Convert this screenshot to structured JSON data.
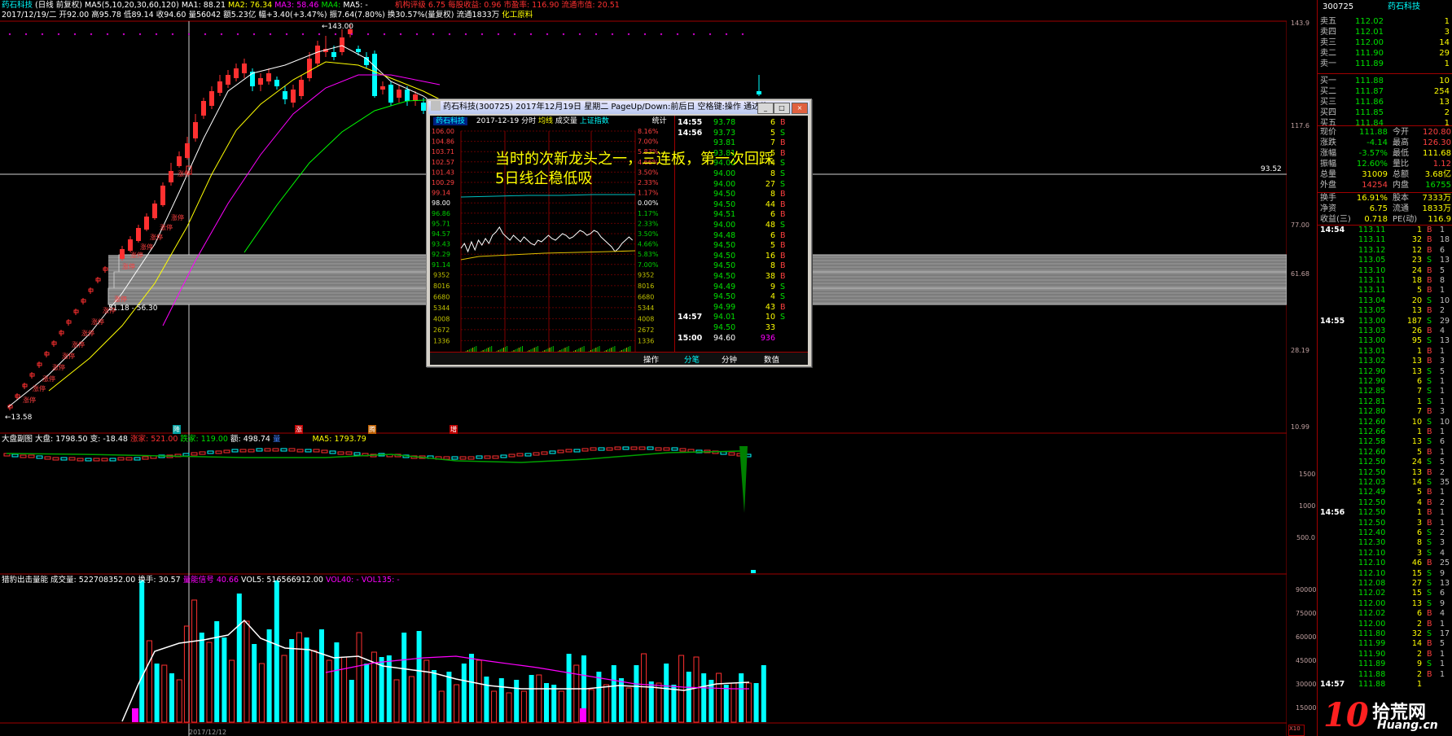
{
  "main_header": {
    "name": "药石科技",
    "period": "(日线 前复权)",
    "ma_params": "MA5(5,10,20,30,60,120)",
    "ma1": "MA1: 88.21",
    "ma2": "MA2: 76.34",
    "ma3": "MA3: 58.46",
    "ma4": "MA4:",
    "ma5": "MA5: -",
    "ratings": "机构评级",
    "profit": "6.75 每股收益: 0.96 市盈率: 116.90 流通市值: 20.51"
  },
  "info_line": {
    "date": "2017/12/19/二",
    "open": "开92.00",
    "high": "高95.78",
    "low": "低89.14",
    "close": "收94.60",
    "volume": "量56042",
    "amount": "额5.23亿",
    "change": "幅+3.40(+3.47%)",
    "amplitude": "振7.64(7.80%)",
    "turnover": "换30.57%(量复权)",
    "float_shares": "流通1833万",
    "industry": "化工原料"
  },
  "price_labels": {
    "high": "143.00",
    "low": "13.58",
    "band": "51.18 - 56.30",
    "right_mark": "93.52"
  },
  "right_axis": [
    "143.9",
    "117.6",
    "77.00",
    "61.68",
    "28.19",
    "10.99"
  ],
  "up_limit_text": "涨停",
  "candle_markers": [
    "降",
    "涨",
    "腾",
    "增"
  ],
  "index_header": {
    "title": "大盘副图",
    "dapan": "大盘: 1798.50",
    "change": "变: -18.48",
    "up": "涨家: 521.00",
    "down": "跌家: 119.00",
    "amount": "额: 498.74",
    "vol": "量",
    "ma5": "MA5: 1793.79"
  },
  "index_axis": [
    "1500",
    "1000",
    "500.0"
  ],
  "volume_header": {
    "title": "猎豹出击量能",
    "volume": "成交量: 522708352.00",
    "turnover": "换手: 30.57",
    "signal": "量能信号",
    "signal_val": "40.66",
    "vol5": "VOL5: 516566912.00",
    "vol40": "VOL40: -",
    "vol135": "VOL135: -"
  },
  "volume_axis": [
    "90000",
    "75000",
    "60000",
    "45000",
    "30000",
    "15000"
  ],
  "bottom_axis": [
    "2017/12/12",
    "X10"
  ],
  "annotation": {
    "line1": "当时的次新龙头之一，三连板，第一次回踩",
    "line2": "5日线企稳低吸"
  },
  "popup": {
    "title": "药石科技(300725) 2017年12月19日 星期二 PageUp/Down:前后日 空格键:操作 通达信(R)",
    "tab_name": "药石科技",
    "tab_date": "2017-12-19",
    "tab_fenshi": "分时",
    "tab_avg": "均线",
    "tab_vol": "成交量",
    "tab_index": "上证指数",
    "tab_stat": "统计",
    "left_axis": [
      "106.00",
      "104.86",
      "103.71",
      "102.57",
      "101.43",
      "100.29",
      "99.14",
      "98.00",
      "96.86",
      "95.71",
      "94.57",
      "93.43",
      "92.29",
      "91.14",
      "9352",
      "8016",
      "6680",
      "5344",
      "4008",
      "2672",
      "1336"
    ],
    "right_axis": [
      "8.16%",
      "7.00%",
      "5.83%",
      "4.66%",
      "3.50%",
      "2.33%",
      "1.17%",
      "0.00%",
      "1.17%",
      "2.33%",
      "3.50%",
      "4.66%",
      "5.83%",
      "7.00%",
      "9352",
      "8016",
      "6680",
      "5344",
      "4008",
      "2672",
      "1336"
    ],
    "time_axis": [
      "09:30",
      "10:30",
      "13:00",
      "14:00"
    ],
    "btn_op": "操作",
    "btn_tabs": [
      "分笔",
      "分钟",
      "数值"
    ],
    "ticks": [
      {
        "t": "14:55",
        "p": "93.78",
        "v": "6",
        "d": "B"
      },
      {
        "t": "14:56",
        "p": "93.73",
        "v": "5",
        "d": "S"
      },
      {
        "t": "",
        "p": "93.81",
        "v": "7",
        "d": "B"
      },
      {
        "t": "",
        "p": "93.81",
        "v": "5",
        "d": "B"
      },
      {
        "t": "",
        "p": "94.00",
        "v": "4",
        "d": "S"
      },
      {
        "t": "",
        "p": "94.00",
        "v": "8",
        "d": "S"
      },
      {
        "t": "",
        "p": "94.00",
        "v": "27",
        "d": "S"
      },
      {
        "t": "",
        "p": "94.50",
        "v": "8",
        "d": "B"
      },
      {
        "t": "",
        "p": "94.50",
        "v": "44",
        "d": "B"
      },
      {
        "t": "",
        "p": "94.51",
        "v": "6",
        "d": "B"
      },
      {
        "t": "",
        "p": "94.00",
        "v": "48",
        "d": "S"
      },
      {
        "t": "",
        "p": "94.48",
        "v": "6",
        "d": "B"
      },
      {
        "t": "",
        "p": "94.50",
        "v": "5",
        "d": "B"
      },
      {
        "t": "",
        "p": "94.50",
        "v": "16",
        "d": "B"
      },
      {
        "t": "",
        "p": "94.50",
        "v": "8",
        "d": "B"
      },
      {
        "t": "",
        "p": "94.50",
        "v": "38",
        "d": "B"
      },
      {
        "t": "",
        "p": "94.49",
        "v": "9",
        "d": "S"
      },
      {
        "t": "",
        "p": "94.50",
        "v": "4",
        "d": "S"
      },
      {
        "t": "",
        "p": "94.99",
        "v": "43",
        "d": "B"
      },
      {
        "t": "14:57",
        "p": "94.01",
        "v": "10",
        "d": "S"
      },
      {
        "t": "",
        "p": "94.50",
        "v": "33",
        "d": ""
      },
      {
        "t": "15:00",
        "p": "94.60",
        "v": "936",
        "d": ""
      }
    ]
  },
  "quote": {
    "code": "300725",
    "name": "药石科技",
    "asks": [
      {
        "label": "卖五",
        "price": "112.02",
        "vol": "1"
      },
      {
        "label": "卖四",
        "price": "112.01",
        "vol": "3"
      },
      {
        "label": "卖三",
        "price": "112.00",
        "vol": "14"
      },
      {
        "label": "卖二",
        "price": "111.90",
        "vol": "29"
      },
      {
        "label": "卖一",
        "price": "111.89",
        "vol": "1"
      }
    ],
    "bids": [
      {
        "label": "买一",
        "price": "111.88",
        "vol": "10"
      },
      {
        "label": "买二",
        "price": "111.87",
        "vol": "254"
      },
      {
        "label": "买三",
        "price": "111.86",
        "vol": "13"
      },
      {
        "label": "买四",
        "price": "111.85",
        "vol": "2"
      },
      {
        "label": "买五",
        "price": "111.84",
        "vol": "1"
      }
    ],
    "stats": [
      {
        "l1": "现价",
        "v1": "111.88",
        "l2": "今开",
        "v2": "120.80"
      },
      {
        "l1": "涨跌",
        "v1": "-4.14",
        "l2": "最高",
        "v2": "126.30"
      },
      {
        "l1": "涨幅",
        "v1": "-3.57%",
        "l2": "最低",
        "v2": "111.68"
      },
      {
        "l1": "振幅",
        "v1": "12.60%",
        "l2": "量比",
        "v2": "1.12"
      },
      {
        "l1": "总量",
        "v1": "31009",
        "l2": "总额",
        "v2": "3.68亿"
      },
      {
        "l1": "外盘",
        "v1": "14254",
        "l2": "内盘",
        "v2": "16755"
      },
      {
        "l1": "换手",
        "v1": "16.91%",
        "l2": "股本",
        "v2": "7333万"
      },
      {
        "l1": "净资",
        "v1": "6.75",
        "l2": "流通",
        "v2": "1833万"
      },
      {
        "l1": "收益(三)",
        "v1": "0.718",
        "l2": "PE(动)",
        "v2": "116.9"
      }
    ],
    "ticks": [
      {
        "t": "14:54",
        "p": "113.11",
        "v": "1",
        "d": "B",
        "n": "1"
      },
      {
        "t": "",
        "p": "113.11",
        "v": "32",
        "d": "B",
        "n": "18"
      },
      {
        "t": "",
        "p": "113.12",
        "v": "12",
        "d": "B",
        "n": "6"
      },
      {
        "t": "",
        "p": "113.05",
        "v": "23",
        "d": "S",
        "n": "13"
      },
      {
        "t": "",
        "p": "113.10",
        "v": "24",
        "d": "B",
        "n": "5"
      },
      {
        "t": "",
        "p": "113.11",
        "v": "18",
        "d": "B",
        "n": "8"
      },
      {
        "t": "",
        "p": "113.11",
        "v": "5",
        "d": "B",
        "n": "1"
      },
      {
        "t": "",
        "p": "113.04",
        "v": "20",
        "d": "S",
        "n": "10"
      },
      {
        "t": "",
        "p": "113.05",
        "v": "13",
        "d": "B",
        "n": "2"
      },
      {
        "t": "14:55",
        "p": "113.00",
        "v": "187",
        "d": "S",
        "n": "29"
      },
      {
        "t": "",
        "p": "113.03",
        "v": "26",
        "d": "B",
        "n": "4"
      },
      {
        "t": "",
        "p": "113.00",
        "v": "95",
        "d": "S",
        "n": "13"
      },
      {
        "t": "",
        "p": "113.01",
        "v": "1",
        "d": "B",
        "n": "1"
      },
      {
        "t": "",
        "p": "113.02",
        "v": "13",
        "d": "B",
        "n": "3"
      },
      {
        "t": "",
        "p": "112.90",
        "v": "13",
        "d": "S",
        "n": "5"
      },
      {
        "t": "",
        "p": "112.90",
        "v": "6",
        "d": "S",
        "n": "1"
      },
      {
        "t": "",
        "p": "112.85",
        "v": "7",
        "d": "S",
        "n": "1"
      },
      {
        "t": "",
        "p": "112.81",
        "v": "1",
        "d": "S",
        "n": "1"
      },
      {
        "t": "",
        "p": "112.80",
        "v": "7",
        "d": "B",
        "n": "3"
      },
      {
        "t": "",
        "p": "112.60",
        "v": "10",
        "d": "S",
        "n": "10"
      },
      {
        "t": "",
        "p": "112.66",
        "v": "1",
        "d": "B",
        "n": "1"
      },
      {
        "t": "",
        "p": "112.58",
        "v": "13",
        "d": "S",
        "n": "6"
      },
      {
        "t": "",
        "p": "112.60",
        "v": "5",
        "d": "B",
        "n": "1"
      },
      {
        "t": "",
        "p": "112.50",
        "v": "24",
        "d": "S",
        "n": "5"
      },
      {
        "t": "",
        "p": "112.50",
        "v": "13",
        "d": "B",
        "n": "2"
      },
      {
        "t": "",
        "p": "112.03",
        "v": "14",
        "d": "S",
        "n": "35"
      },
      {
        "t": "",
        "p": "112.49",
        "v": "5",
        "d": "B",
        "n": "1"
      },
      {
        "t": "",
        "p": "112.50",
        "v": "4",
        "d": "B",
        "n": "2"
      },
      {
        "t": "14:56",
        "p": "112.50",
        "v": "1",
        "d": "B",
        "n": "1"
      },
      {
        "t": "",
        "p": "112.50",
        "v": "3",
        "d": "B",
        "n": "1"
      },
      {
        "t": "",
        "p": "112.40",
        "v": "6",
        "d": "S",
        "n": "2"
      },
      {
        "t": "",
        "p": "112.30",
        "v": "8",
        "d": "S",
        "n": "3"
      },
      {
        "t": "",
        "p": "112.10",
        "v": "3",
        "d": "S",
        "n": "4"
      },
      {
        "t": "",
        "p": "112.10",
        "v": "46",
        "d": "B",
        "n": "25"
      },
      {
        "t": "",
        "p": "112.10",
        "v": "15",
        "d": "S",
        "n": "9"
      },
      {
        "t": "",
        "p": "112.08",
        "v": "27",
        "d": "S",
        "n": "13"
      },
      {
        "t": "",
        "p": "112.02",
        "v": "15",
        "d": "S",
        "n": "6"
      },
      {
        "t": "",
        "p": "112.00",
        "v": "13",
        "d": "S",
        "n": "9"
      },
      {
        "t": "",
        "p": "112.02",
        "v": "6",
        "d": "B",
        "n": "4"
      },
      {
        "t": "",
        "p": "112.00",
        "v": "2",
        "d": "B",
        "n": "1"
      },
      {
        "t": "",
        "p": "111.80",
        "v": "32",
        "d": "S",
        "n": "17"
      },
      {
        "t": "",
        "p": "111.99",
        "v": "14",
        "d": "B",
        "n": "5"
      },
      {
        "t": "",
        "p": "111.90",
        "v": "2",
        "d": "B",
        "n": "1"
      },
      {
        "t": "",
        "p": "111.89",
        "v": "9",
        "d": "S",
        "n": "1"
      },
      {
        "t": "",
        "p": "111.88",
        "v": "2",
        "d": "B",
        "n": "1"
      },
      {
        "t": "14:57",
        "p": "111.88",
        "v": "1",
        "d": "",
        "n": ""
      }
    ]
  },
  "watermark": {
    "num": "10",
    "cn": "拾荒网",
    "url": "Huang.cn"
  },
  "colors": {
    "up": "#ff3030",
    "down": "#00ffff",
    "ma1": "#ffffff",
    "ma2": "#ffff00",
    "ma3": "#ff00ff",
    "ma4": "#00ff00"
  }
}
